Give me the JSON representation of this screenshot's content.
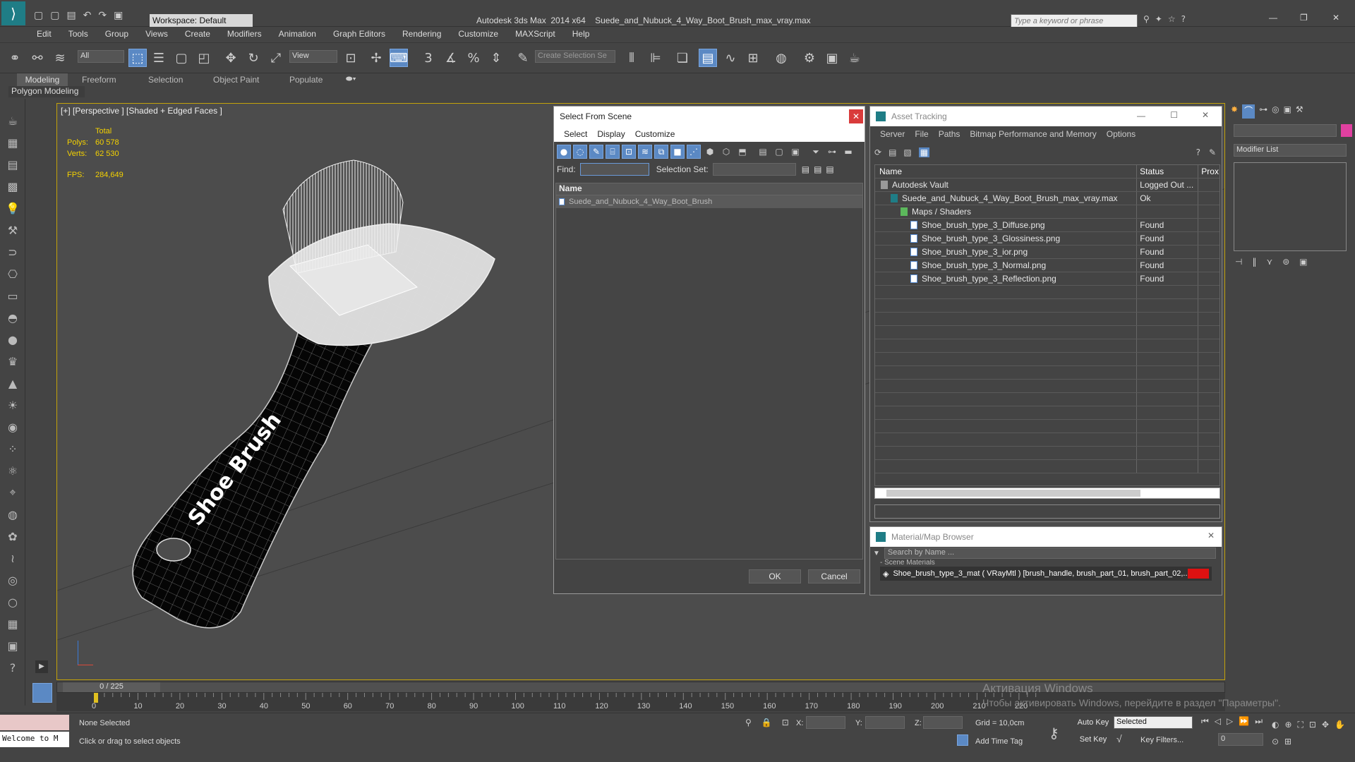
{
  "app": {
    "title": "Autodesk 3ds Max  2014 x64    Suede_and_Nubuck_4_Way_Boot_Brush_max_vray.max",
    "workspace": "Workspace: Default",
    "search_placeholder": "Type a keyword or phrase"
  },
  "menu": [
    "Edit",
    "Tools",
    "Group",
    "Views",
    "Create",
    "Modifiers",
    "Animation",
    "Graph Editors",
    "Rendering",
    "Customize",
    "MAXScript",
    "Help"
  ],
  "toolbar": {
    "filter": "All",
    "refcoord": "View",
    "selset": "Create Selection Se"
  },
  "ribbon": {
    "tabs": [
      "Modeling",
      "Freeform",
      "Selection",
      "Object Paint",
      "Populate"
    ],
    "sub": "Polygon Modeling"
  },
  "viewport": {
    "label": "[+] [Perspective ] [Shaded + Edged Faces ]",
    "stats": {
      "total": "Total",
      "polys_label": "Polys:",
      "polys": "60 578",
      "verts_label": "Verts:",
      "verts": "62 530",
      "fps_label": "FPS:",
      "fps": "284,649"
    },
    "brush_text": "Shoe Brush"
  },
  "select_scene": {
    "title": "Select From Scene",
    "menu": [
      "Select",
      "Display",
      "Customize"
    ],
    "find_label": "Find:",
    "selset_label": "Selection Set:",
    "col_name": "Name",
    "item": "Suede_and_Nubuck_4_Way_Boot_Brush",
    "ok": "OK",
    "cancel": "Cancel"
  },
  "asset": {
    "title": "Asset Tracking",
    "menu": [
      "Server",
      "File",
      "Paths",
      "Bitmap Performance and Memory",
      "Options"
    ],
    "cols": [
      "Name",
      "Status",
      "Prox"
    ],
    "rows": [
      {
        "name": "Autodesk Vault",
        "status": "Logged Out ...",
        "indent": 0
      },
      {
        "name": "Suede_and_Nubuck_4_Way_Boot_Brush_max_vray.max",
        "status": "Ok",
        "indent": 1
      },
      {
        "name": "Maps / Shaders",
        "status": "",
        "indent": 2
      },
      {
        "name": "Shoe_brush_type_3_Diffuse.png",
        "status": "Found",
        "indent": 3
      },
      {
        "name": "Shoe_brush_type_3_Glossiness.png",
        "status": "Found",
        "indent": 3
      },
      {
        "name": "Shoe_brush_type_3_ior.png",
        "status": "Found",
        "indent": 3
      },
      {
        "name": "Shoe_brush_type_3_Normal.png",
        "status": "Found",
        "indent": 3
      },
      {
        "name": "Shoe_brush_type_3_Reflection.png",
        "status": "Found",
        "indent": 3
      }
    ]
  },
  "matbrowser": {
    "title": "Material/Map Browser",
    "search": "Search by Name ...",
    "group": "- Scene Materials",
    "item": "Shoe_brush_type_3_mat  ( VRayMtl ) [brush_handle, brush_part_01, brush_part_02,..."
  },
  "cmd": {
    "modlist": "Modifier List"
  },
  "timeline": {
    "frame": "0 / 225",
    "ticks": [
      "0",
      "10",
      "20",
      "30",
      "40",
      "50",
      "60",
      "70",
      "80",
      "90",
      "100",
      "110",
      "120",
      "130",
      "140",
      "150",
      "160",
      "170",
      "180",
      "190",
      "200",
      "210",
      "220"
    ]
  },
  "status": {
    "welcome": "Welcome to M",
    "selected": "None Selected",
    "prompt": "Click or drag to select objects",
    "x": "X:",
    "y": "Y:",
    "z": "Z:",
    "grid": "Grid = 10,0cm",
    "autokey": "Auto Key",
    "setkey": "Set Key",
    "selected_mode": "Selected",
    "keyfilters": "Key Filters...",
    "addtime": "Add Time Tag",
    "frame": "0"
  },
  "watermark": {
    "line1": "Активация Windows",
    "line2": "Чтобы активировать Windows, перейдите в раздел \"Параметры\"."
  }
}
